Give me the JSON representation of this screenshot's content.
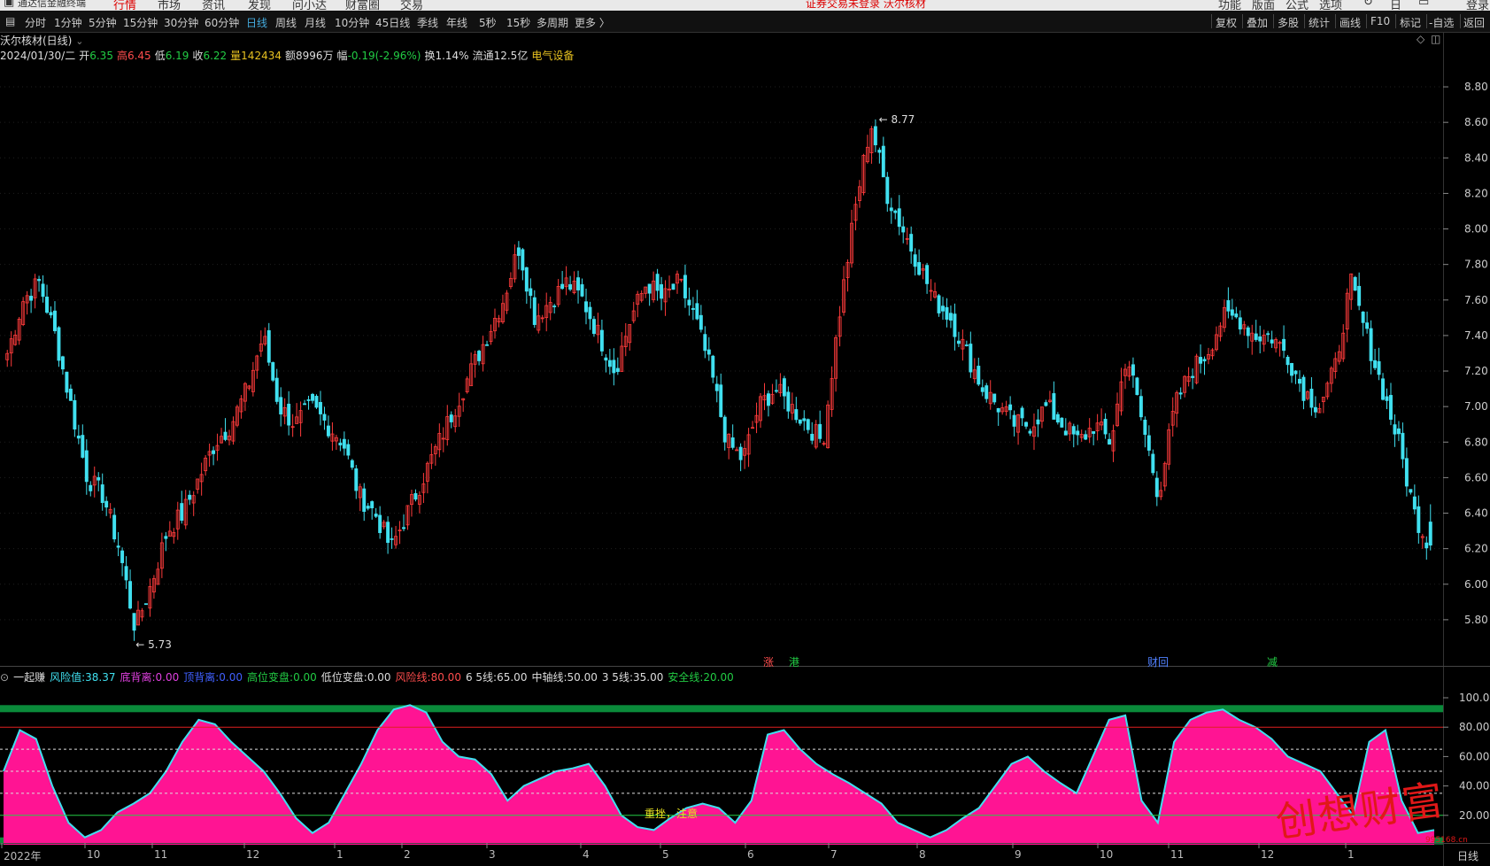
{
  "top_menu": {
    "brand": "通达信金融终端",
    "items": [
      "行情",
      "市场",
      "资讯",
      "发现",
      "问小达",
      "财富圈",
      "交易"
    ],
    "active": "行情",
    "notice": "证券交易未登录 沃尔核材",
    "right_items": [
      "功能",
      "版面",
      "公式",
      "选项",
      "",
      "日",
      ""
    ],
    "login": "登录"
  },
  "toolbar": {
    "periods": [
      "分时",
      "1分钟",
      "5分钟",
      "15分钟",
      "30分钟",
      "60分钟",
      "日线",
      "周线",
      "月线",
      "10分钟",
      "45日线",
      "季线",
      "年线",
      "5秒",
      "15秒",
      "多周期",
      "更多 〉"
    ],
    "active_period": "日线",
    "tools": [
      "复权",
      "叠加",
      "多股",
      "统计",
      "画线",
      "F10",
      "标记",
      "-自选",
      "返回"
    ]
  },
  "stock": {
    "title": "沃尔核材(日线)",
    "date": "2024/01/30/二",
    "open_label": "开",
    "open": "6.35",
    "high_label": "高",
    "high": "6.45",
    "low_label": "低",
    "low": "6.19",
    "close_label": "收",
    "close": "6.22",
    "volume_label": "量",
    "volume": "142434",
    "amount_label": "额",
    "amount": "8996万",
    "change_label": "幅",
    "change": "-0.19(-2.96%)",
    "turnover_label": "换",
    "turnover": "1.14%",
    "float_label": "流通",
    "float": "12.5亿",
    "sector": "电气设备"
  },
  "price_axis": {
    "ticks": [
      "8.80",
      "8.60",
      "8.40",
      "8.20",
      "8.00",
      "7.80",
      "7.60",
      "7.40",
      "7.20",
      "7.00",
      "6.80",
      "6.60",
      "6.40",
      "6.20",
      "6.00",
      "5.80"
    ]
  },
  "markers": {
    "max_label": "8.77",
    "min_label": "5.73",
    "events": [
      "涨",
      "港",
      "财回",
      "减"
    ]
  },
  "indicator": {
    "name": "一起赚",
    "items": [
      {
        "label": "风险值:",
        "value": "38.37",
        "color": "#40e0f0"
      },
      {
        "label": "底背离:",
        "value": "0.00",
        "color": "#e040e0"
      },
      {
        "label": "顶背离:",
        "value": "0.00",
        "color": "#4060ff"
      },
      {
        "label": "高位变盘:",
        "value": "0.00",
        "color": "#22cc44"
      },
      {
        "label": "低位变盘:",
        "value": "0.00",
        "color": "#dddddd"
      },
      {
        "label": "风险线:",
        "value": "80.00",
        "color": "#ff4d4d"
      },
      {
        "label": "6 5线:",
        "value": "65.00",
        "color": "#dddddd"
      },
      {
        "label": "中轴线:",
        "value": "50.00",
        "color": "#dddddd"
      },
      {
        "label": "3 5线:",
        "value": "35.00",
        "color": "#dddddd"
      },
      {
        "label": "安全线:",
        "value": "20.00",
        "color": "#22cc44"
      }
    ],
    "axis_ticks": [
      "100.0",
      "80.00",
      "60.00",
      "40.00",
      "20.00"
    ],
    "annotation": "重挫，注意"
  },
  "x_axis": {
    "labels": [
      "2022年",
      "10",
      "11",
      "12",
      "1",
      "2",
      "3",
      "4",
      "5",
      "6",
      "7",
      "8",
      "9",
      "10",
      "11",
      "12",
      "1"
    ],
    "day_button": "日线"
  },
  "watermark": {
    "text": "创想财富",
    "url": "995168.cn"
  },
  "chart_data": [
    {
      "type": "candlestick",
      "title": "沃尔核材(日线)",
      "ylim": [
        5.6,
        8.9
      ],
      "x_labels": [
        "2022年",
        "10",
        "11",
        "12",
        "1",
        "2",
        "3",
        "4",
        "5",
        "6",
        "7",
        "8",
        "9",
        "10",
        "11",
        "12",
        "1"
      ],
      "close_path": [
        7.3,
        7.6,
        7.7,
        7.4,
        7.0,
        6.6,
        6.5,
        6.2,
        5.75,
        6.0,
        6.3,
        6.4,
        6.6,
        6.8,
        6.9,
        7.1,
        7.4,
        7.0,
        6.9,
        7.0,
        6.9,
        6.8,
        6.5,
        6.4,
        6.2,
        6.4,
        6.6,
        6.8,
        7.0,
        7.2,
        7.4,
        7.6,
        7.9,
        7.5,
        7.6,
        7.7,
        7.6,
        7.4,
        7.2,
        7.5,
        7.7,
        7.6,
        7.7,
        7.5,
        7.2,
        6.8,
        6.7,
        7.0,
        7.1,
        7.0,
        6.9,
        6.8,
        7.5,
        8.1,
        8.6,
        8.2,
        8.0,
        7.8,
        7.6,
        7.5,
        7.3,
        7.1,
        7.0,
        6.9,
        6.9,
        7.0,
        6.9,
        6.8,
        6.9,
        6.8,
        7.3,
        6.9,
        6.5,
        7.0,
        7.2,
        7.3,
        7.5,
        7.5,
        7.4,
        7.4,
        7.3,
        7.1,
        7.0,
        7.2,
        7.7,
        7.4,
        7.1,
        6.8,
        6.4,
        6.2
      ],
      "max": 8.77,
      "min": 5.73,
      "last": {
        "date": "2024/01/30",
        "open": 6.35,
        "high": 6.45,
        "low": 6.19,
        "close": 6.22
      }
    },
    {
      "type": "area",
      "title": "一起赚",
      "ylim": [
        0,
        100
      ],
      "series": [
        {
          "name": "风险值",
          "values": [
            50,
            78,
            72,
            40,
            15,
            5,
            10,
            22,
            28,
            35,
            50,
            70,
            85,
            82,
            70,
            60,
            50,
            35,
            18,
            8,
            15,
            35,
            55,
            78,
            92,
            95,
            90,
            70,
            60,
            58,
            48,
            30,
            40,
            45,
            50,
            52,
            55,
            40,
            20,
            12,
            10,
            18,
            25,
            28,
            25,
            15,
            30,
            75,
            78,
            65,
            55,
            48,
            42,
            35,
            28,
            15,
            10,
            5,
            10,
            18,
            25,
            40,
            55,
            60,
            50,
            42,
            35,
            60,
            85,
            88,
            30,
            15,
            70,
            85,
            90,
            92,
            85,
            80,
            72,
            60,
            55,
            50,
            35,
            20,
            70,
            78,
            30,
            8,
            10
          ]
        }
      ],
      "lines": {
        "风险线": 80,
        "6 5线": 65,
        "中轴线": 50,
        "3 5线": 35,
        "安全线": 20
      },
      "last_value": 38.37
    }
  ],
  "colors": {
    "up": "#ff3b3b",
    "down": "#40e0f0",
    "area": "#ff1493",
    "area_line": "#40e0f0",
    "band": "#0a8a3a"
  }
}
